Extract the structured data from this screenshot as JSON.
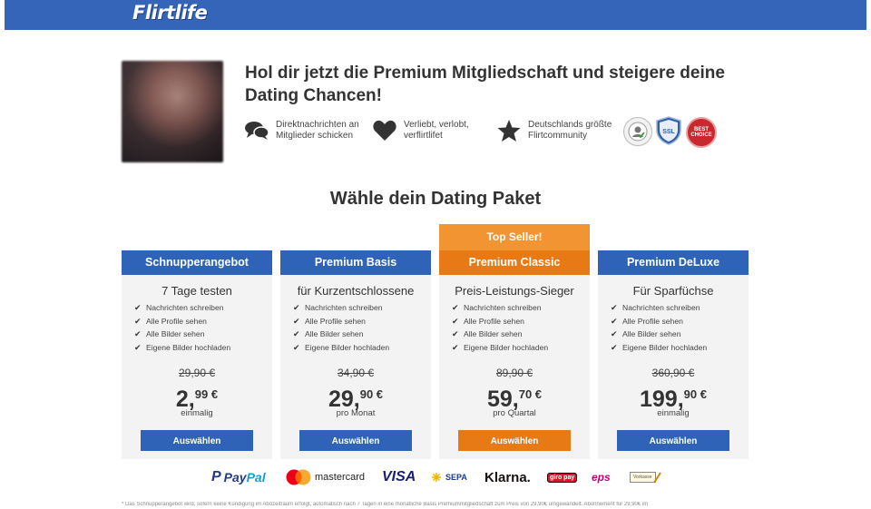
{
  "header": {
    "logo_text": "Flirtlife",
    "bar_color": "#3565b8"
  },
  "hero": {
    "headline": "Hol dir jetzt die Premium Mitgliedschaft und steigere deine Dating Chancen!",
    "features": [
      {
        "icon": "chat-bubbles-icon",
        "text": "Direktnachrichten an Mitglieder schicken"
      },
      {
        "icon": "heart-icon",
        "text": "Verliebt, verlobt, verflirtlifet"
      },
      {
        "icon": "star-icon",
        "text": "Deutschlands größte Flirtcommunity"
      }
    ],
    "badges": [
      {
        "icon": "verified-profile-badge",
        "label": ""
      },
      {
        "icon": "ssl-shield-badge",
        "label": "SSL"
      },
      {
        "icon": "best-choice-badge",
        "label": "BEST CHOICE"
      }
    ]
  },
  "section_title": "Wähle dein Dating Paket",
  "top_seller_label": "Top Seller!",
  "packages": [
    {
      "name": "Schnupperangebot",
      "subtitle": "7 Tage testen",
      "old_price": "29,90 €",
      "price_main": "2,",
      "price_sup": "99 €",
      "period": "einmalig",
      "button": "Auswählen"
    },
    {
      "name": "Premium Basis",
      "subtitle": "für Kurzentschlossene",
      "old_price": "34,90 €",
      "price_main": "29,",
      "price_sup": "90 €",
      "period": "pro Monat",
      "button": "Auswählen"
    },
    {
      "name": "Premium Classic",
      "subtitle": "Preis-Leistungs-Sieger",
      "old_price": "89,90 €",
      "price_main": "59,",
      "price_sup": "70 €",
      "period": "pro Quartal",
      "button": "Auswählen"
    },
    {
      "name": "Premium DeLuxe",
      "subtitle": "Für Sparfüchse",
      "old_price": "360,90 €",
      "price_main": "199,",
      "price_sup": "90 €",
      "period": "einmalig",
      "button": "Auswählen"
    }
  ],
  "package_features": [
    "Nachrichten schreiben",
    "Alle Profile sehen",
    "Alle Bilder sehen",
    "Eigene Bilder hochladen"
  ],
  "payments": {
    "paypal": {
      "a": "P",
      "b": "Pay",
      "c": "Pal"
    },
    "mastercard": "mastercard",
    "visa": "VISA",
    "sepa": "SEPA",
    "klarna": "Klarna.",
    "giropay": "giro pay",
    "eps": "eps",
    "invoice": "Vorkasse"
  },
  "footnote": "* Das Schnupperangebot wird, sofern keine Kündigung im Abozeitraum erfolgt, automatisch nach 7 Tagen in eine monatliche Basis Premiummitgliedschaft zum Preis von 29,90€ umgewandelt. Abonnement für 29,90€ im",
  "colors": {
    "blue": "#2f63b8",
    "orange": "#e87a16",
    "top_seller": "#f19431",
    "card_bg": "#f3f3f3"
  }
}
